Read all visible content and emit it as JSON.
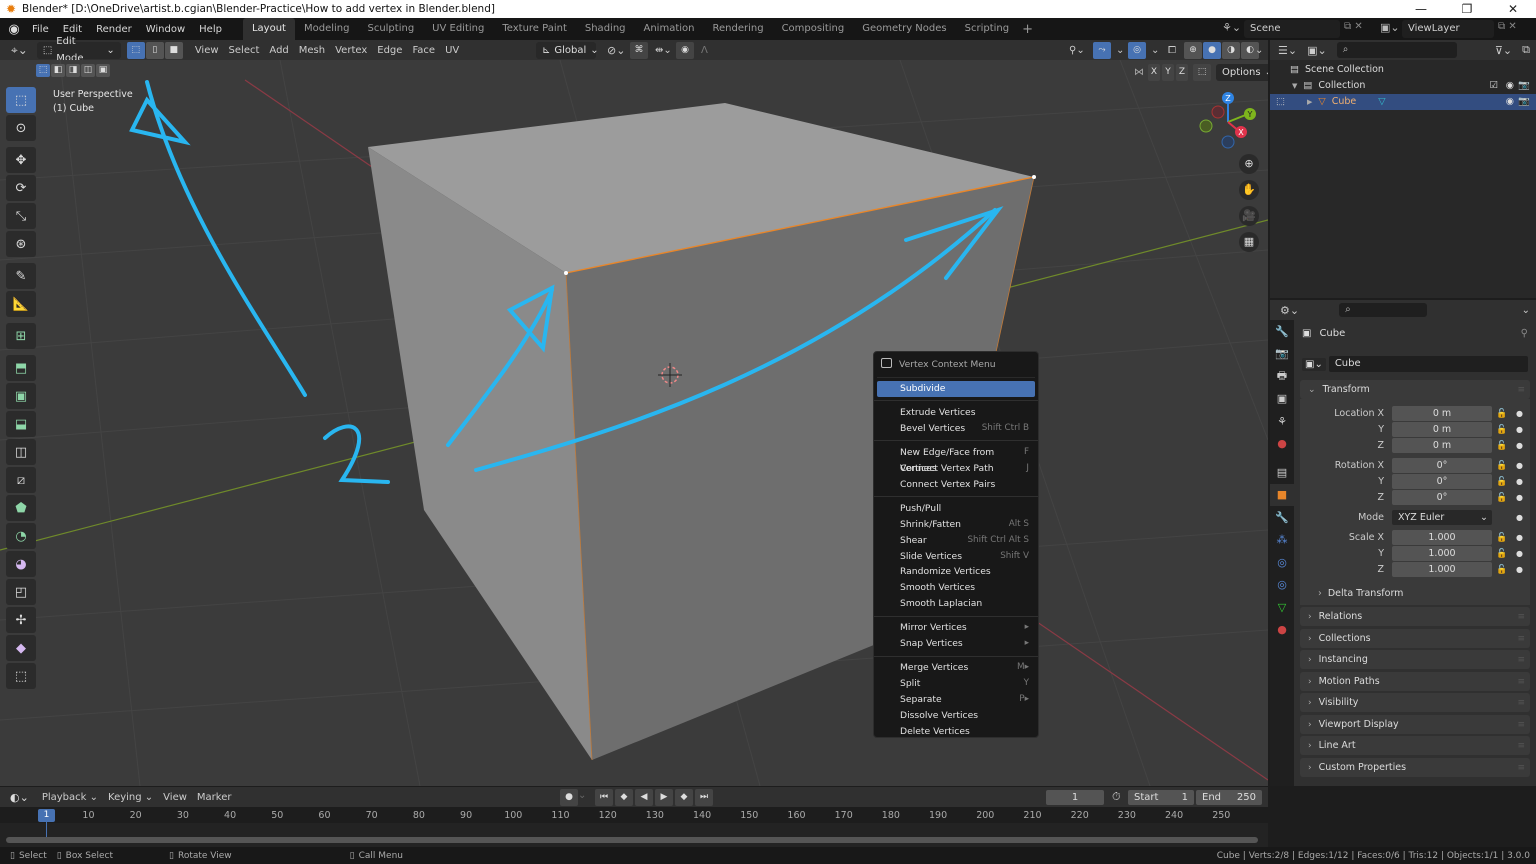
{
  "window": {
    "title": "Blender* [D:\\OneDrive\\artist.b.cgian\\Blender-Practice\\How to add vertex in Blender.blend]",
    "controls": {
      "minimize": "—",
      "restore": "❐",
      "close": "✕"
    }
  },
  "topbar": {
    "menus": [
      "File",
      "Edit",
      "Render",
      "Window",
      "Help"
    ],
    "workspaces": [
      "Layout",
      "Modeling",
      "Sculpting",
      "UV Editing",
      "Texture Paint",
      "Shading",
      "Animation",
      "Rendering",
      "Compositing",
      "Geometry Nodes",
      "Scripting"
    ],
    "active_workspace": "Layout",
    "add_workspace": "+",
    "scene": "Scene",
    "view_layer": "ViewLayer"
  },
  "viewport_header": {
    "mode": "Edit Mode",
    "select_modes": [
      "vertex",
      "edge",
      "face"
    ],
    "active_select_mode": "vertex",
    "menus": [
      "View",
      "Select",
      "Add",
      "Mesh",
      "Vertex",
      "Edge",
      "Face",
      "UV"
    ],
    "orientation": "Global",
    "mirror_axes": [
      "X",
      "Y",
      "Z"
    ],
    "options_label": "Options"
  },
  "viewport": {
    "overlay_line1": "User Perspective",
    "overlay_line2": "(1) Cube",
    "annotation_label": "2",
    "gizmo_axes": [
      "Z",
      "Y",
      "X"
    ],
    "nav_buttons": [
      "zoom-icon",
      "hand-pan-icon",
      "camera-icon",
      "grid-ortho-icon"
    ],
    "tools": [
      "select-box",
      "cursor",
      "move",
      "rotate",
      "scale",
      "transform",
      "annotate",
      "measure",
      "add-cube",
      "extrude-region",
      "inset-faces",
      "bevel",
      "loop-cut",
      "knife",
      "poly-build",
      "spin",
      "smooth",
      "edge-slide",
      "shrink-fatten",
      "shear",
      "rip-region"
    ]
  },
  "context_menu": {
    "title": "Vertex Context Menu",
    "groups": [
      [
        {
          "label": "Subdivide",
          "shortcut": "",
          "highlighted": true
        }
      ],
      [
        {
          "label": "Extrude Vertices",
          "shortcut": ""
        },
        {
          "label": "Bevel Vertices",
          "shortcut": "Shift Ctrl B"
        }
      ],
      [
        {
          "label": "New Edge/Face from Vertices",
          "shortcut": "F"
        },
        {
          "label": "Connect Vertex Path",
          "shortcut": "J"
        },
        {
          "label": "Connect Vertex Pairs",
          "shortcut": ""
        }
      ],
      [
        {
          "label": "Push/Pull",
          "shortcut": ""
        },
        {
          "label": "Shrink/Fatten",
          "shortcut": "Alt S"
        },
        {
          "label": "Shear",
          "shortcut": "Shift Ctrl Alt S"
        },
        {
          "label": "Slide Vertices",
          "shortcut": "Shift V"
        },
        {
          "label": "Randomize Vertices",
          "shortcut": ""
        },
        {
          "label": "Smooth Vertices",
          "shortcut": ""
        },
        {
          "label": "Smooth Laplacian",
          "shortcut": ""
        }
      ],
      [
        {
          "label": "Mirror Vertices",
          "shortcut": "▸"
        },
        {
          "label": "Snap Vertices",
          "shortcut": "▸"
        }
      ],
      [
        {
          "label": "Merge Vertices",
          "shortcut": "M▸"
        },
        {
          "label": "Split",
          "shortcut": "Y"
        },
        {
          "label": "Separate",
          "shortcut": "P▸"
        },
        {
          "label": "Dissolve Vertices",
          "shortcut": ""
        },
        {
          "label": "Delete Vertices",
          "shortcut": ""
        }
      ]
    ]
  },
  "outliner": {
    "rows": [
      {
        "label": "Scene Collection"
      },
      {
        "label": "Collection"
      },
      {
        "label": "Cube",
        "selected": true
      }
    ]
  },
  "properties": {
    "object_name": "Cube",
    "datablock_name": "Cube",
    "transform_label": "Transform",
    "location": {
      "label": "Location X",
      "x": "0 m",
      "y": "0 m",
      "z": "0 m"
    },
    "rotation": {
      "label": "Rotation X",
      "x": "0°",
      "y": "0°",
      "z": "0°"
    },
    "mode": {
      "label": "Mode",
      "value": "XYZ Euler"
    },
    "scale": {
      "label": "Scale X",
      "x": "1.000",
      "y": "1.000",
      "z": "1.000"
    },
    "axis_labels": {
      "y": "Y",
      "z": "Z"
    },
    "delta_transform": "Delta Transform",
    "panels": [
      "Relations",
      "Collections",
      "Instancing",
      "Motion Paths",
      "Visibility",
      "Viewport Display",
      "Line Art",
      "Custom Properties"
    ]
  },
  "timeline": {
    "menus": [
      "Playback",
      "Keying",
      "View",
      "Marker"
    ],
    "current_frame": "1",
    "start_label": "Start",
    "start": "1",
    "end_label": "End",
    "end": "250",
    "ticks": [
      "10",
      "20",
      "30",
      "40",
      "50",
      "60",
      "70",
      "80",
      "90",
      "100",
      "110",
      "120",
      "130",
      "140",
      "150",
      "160",
      "170",
      "180",
      "190",
      "200",
      "210",
      "220",
      "230",
      "240",
      "250"
    ],
    "playhead": "1"
  },
  "statusbar": {
    "hints": [
      "Select",
      "Box Select",
      "Rotate View",
      "Call Menu"
    ],
    "stats": "Cube | Verts:2/8 | Edges:1/12 | Faces:0/6 | Tris:12 | Objects:1/1 | 3.0.0"
  },
  "colors": {
    "accent": "#4772b3",
    "annotation": "#29b6f0",
    "selected_edge": "#e8862a",
    "axis_x": "#e0334b",
    "axis_y": "#7eb51d",
    "axis_z": "#2f84e3"
  }
}
